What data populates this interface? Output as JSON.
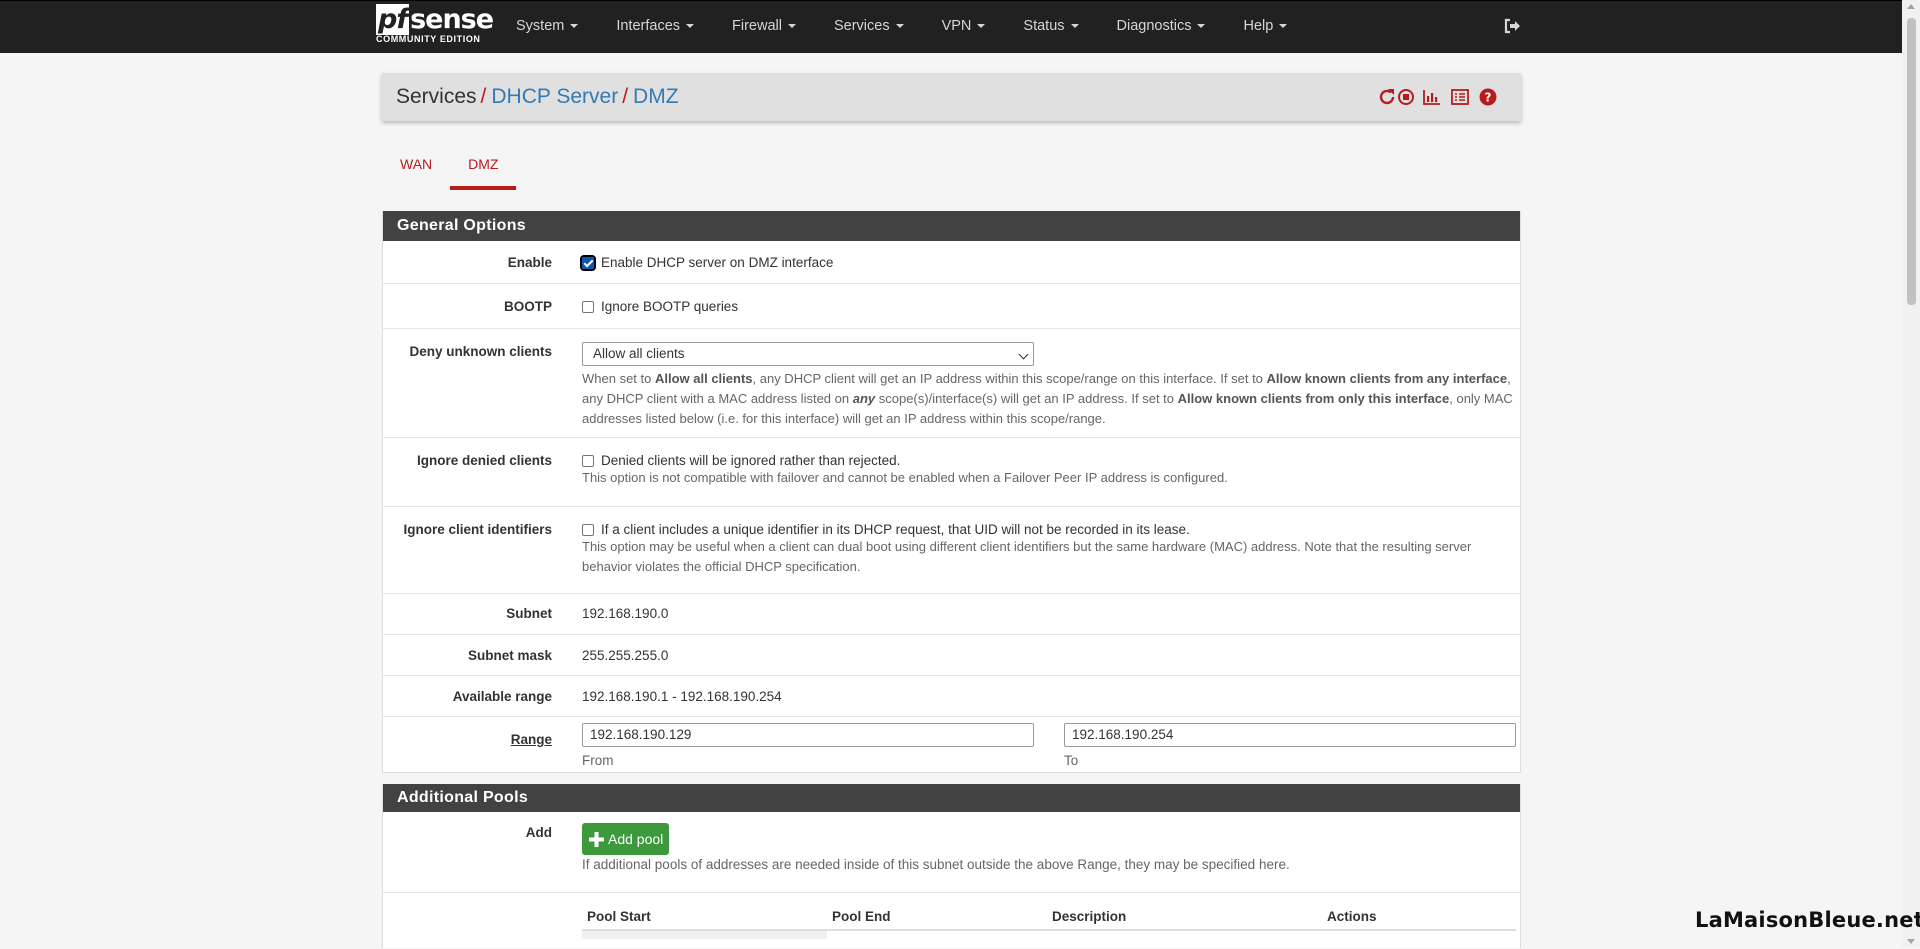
{
  "brand": {
    "logo_pf": "pf",
    "logo_sense": "sense",
    "edition": "COMMUNITY EDITION"
  },
  "menu": [
    {
      "label": "System"
    },
    {
      "label": "Interfaces"
    },
    {
      "label": "Firewall"
    },
    {
      "label": "Services"
    },
    {
      "label": "VPN"
    },
    {
      "label": "Status"
    },
    {
      "label": "Diagnostics"
    },
    {
      "label": "Help"
    }
  ],
  "breadcrumb": {
    "root": "Services",
    "sep": "/",
    "level1": "DHCP Server",
    "level2": "DMZ"
  },
  "tabs": [
    {
      "label": "WAN",
      "active": false
    },
    {
      "label": "DMZ",
      "active": true
    }
  ],
  "general": {
    "title": "General Options",
    "enable": {
      "label": "Enable",
      "checkbox_text": "Enable DHCP server on DMZ interface",
      "checked": true
    },
    "bootp": {
      "label": "BOOTP",
      "checkbox_text": "Ignore BOOTP queries",
      "checked": false
    },
    "deny": {
      "label": "Deny unknown clients",
      "selected": "Allow all clients",
      "help_1": "When set to ",
      "help_b1": "Allow all clients",
      "help_2": ", any DHCP client will get an IP address within this scope/range on this interface. If set to ",
      "help_b2": "Allow known clients from any interface",
      "help_3": ", any DHCP client with a MAC address listed on ",
      "help_b3": "any",
      "help_4": " scope(s)/interface(s) will get an IP address. If set to ",
      "help_b4": "Allow known clients from only this interface",
      "help_5": ", only MAC addresses listed below (i.e. for this interface) will get an IP address within this scope/range."
    },
    "ignore_denied": {
      "label": "Ignore denied clients",
      "checkbox_text": "Denied clients will be ignored rather than rejected.",
      "checked": false,
      "help": "This option is not compatible with failover and cannot be enabled when a Failover Peer IP address is configured."
    },
    "ignore_ids": {
      "label": "Ignore client identifiers",
      "checkbox_text": "If a client includes a unique identifier in its DHCP request, that UID will not be recorded in its lease.",
      "checked": false,
      "help": "This option may be useful when a client can dual boot using different client identifiers but the same hardware (MAC) address. Note that the resulting server behavior violates the official DHCP specification."
    },
    "subnet": {
      "label": "Subnet",
      "value": "192.168.190.0"
    },
    "mask": {
      "label": "Subnet mask",
      "value": "255.255.255.0"
    },
    "available": {
      "label": "Available range",
      "value": "192.168.190.1 - 192.168.190.254"
    },
    "range": {
      "label": "Range",
      "from_value": "192.168.190.129",
      "from_label": "From",
      "to_value": "192.168.190.254",
      "to_label": "To"
    }
  },
  "pools": {
    "title": "Additional Pools",
    "add_label": "Add",
    "add_button": "Add pool",
    "help": "If additional pools of addresses are needed inside of this subnet outside the above Range, they may be specified here.",
    "columns": [
      "Pool Start",
      "Pool End",
      "Description",
      "Actions"
    ]
  },
  "watermark": "LaMaisonBleue.net",
  "icons": [
    "refresh-icon",
    "stop-icon",
    "chart-icon",
    "list-icon",
    "help-icon",
    "logout-icon",
    "plus-icon"
  ],
  "colors": {
    "navbar": "#212121",
    "accent_red": "#b71c1c",
    "link_blue": "#337ab7",
    "panel_head": "#424242",
    "add_green": "#3c9a3c"
  }
}
